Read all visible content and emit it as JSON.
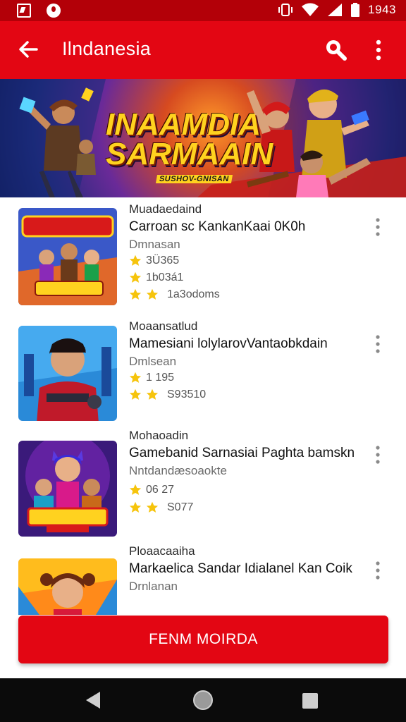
{
  "status_bar": {
    "time": "1943"
  },
  "app_bar": {
    "title": "Ilndanesia"
  },
  "banner": {
    "title_line1": "INAAMDIA",
    "title_line2": "SARMAAIN",
    "subtitle": "SUSHOV-GNISAN"
  },
  "games": [
    {
      "developer": "Muadaedaind",
      "name": "Carroan sc KankanKaai 0K0h",
      "category": "Dmnasan",
      "rating_line1": "3Ü365",
      "rating_line2": "1b03á1",
      "rating_line3": "1a3odoms"
    },
    {
      "developer": "Moaansatlud",
      "name": "Mamesiani lolylarovVantaobkdain",
      "category": "Dmlsean",
      "rating_line1": "1 195",
      "rating_line2": "S93510",
      "rating_line3": ""
    },
    {
      "developer": "Mohaoadin",
      "name": "Gamebanid Sarnasiai Paghta bamskn",
      "category": "Nntdandæsoaokte",
      "rating_line1": "06 27",
      "rating_line2": "S077",
      "rating_line3": ""
    },
    {
      "developer": "Ploaacaaiha",
      "name": "Markaelica Sandar Idialanel Kan Coik",
      "category": "Drnlanan",
      "rating_line1": "",
      "rating_line2": "",
      "rating_line3": ""
    }
  ],
  "fab": {
    "label": "FENM MOIRDA"
  },
  "colors": {
    "primary": "#e30613",
    "status": "#b30008",
    "star": "#f6c40c"
  },
  "icons": [
    "back-arrow-icon",
    "search-icon",
    "more-vert-icon",
    "star-icon"
  ]
}
